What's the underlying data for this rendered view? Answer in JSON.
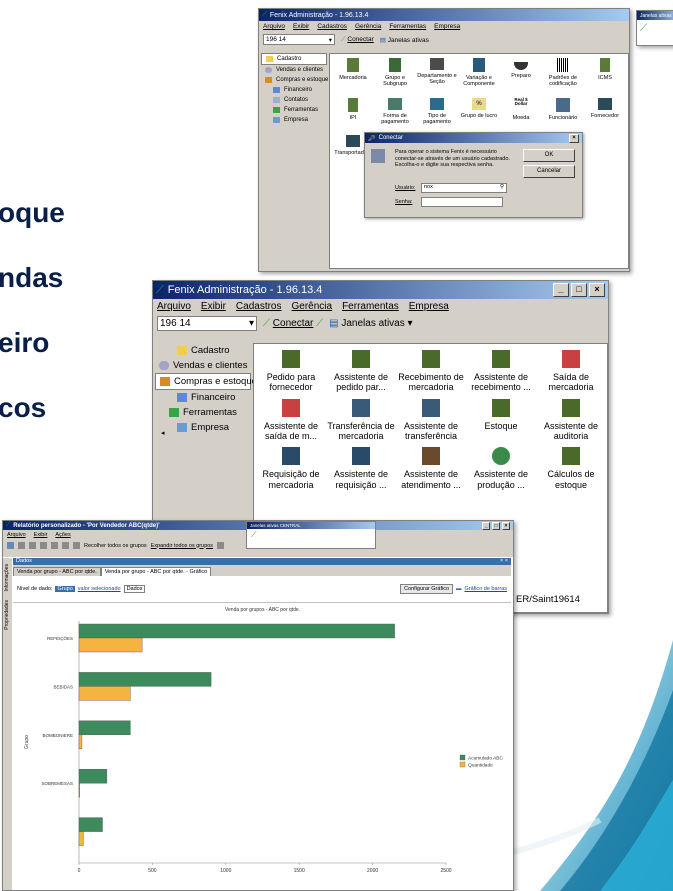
{
  "slide": {
    "bullets": [
      "oque",
      "ndas",
      "eiro",
      "cos"
    ]
  },
  "window_back": {
    "title": "Fenix Administração - 1.96.13.4",
    "menu": [
      "Arquivo",
      "Exibir",
      "Cadastros",
      "Gerência",
      "Ferramentas",
      "Empresa"
    ],
    "combo_value": "196 14",
    "conectar": "Conectar",
    "janelas": "Janelas ativas",
    "nav": [
      "Cadastro",
      "Vendas e clientes",
      "Compras e estoque",
      "Financeiro",
      "Contatos",
      "Ferramentas",
      "Empresa"
    ],
    "tiles": [
      "Mercadoria",
      "Grupo e Subgrupo",
      "Departamento e Seção",
      "Variação e Componente",
      "Preparo",
      "Padrões de codificação",
      "ICMS",
      "IPI",
      "Forma de pagamento",
      "Tipo de pagamento",
      "Grupo de lucro",
      "Moeda",
      "Funcionário",
      "Fornecedor",
      "Transportadora"
    ],
    "moeda_icon_text": "Real $ Dollar"
  },
  "mini_janelas": {
    "title": "Janelas ativas"
  },
  "dialog_conectar": {
    "title": "Conectar",
    "message": "Para operar o sistema Fenix é necessário conectar-se através de um usuário cadastrado. Escolha-o e digite sua respectiva senha.",
    "usuario_label": "Usuário:",
    "usuario_value": "nox",
    "senha_label": "Senha:",
    "ok": "OK",
    "cancelar": "Cancelar"
  },
  "window_mid": {
    "title": "Fenix Administração - 1.96.13.4",
    "menu": [
      "Arquivo",
      "Exibir",
      "Cadastros",
      "Gerência",
      "Ferramentas",
      "Empresa"
    ],
    "combo_value": "196 14",
    "conectar": "Conectar",
    "janelas": "Janelas ativas",
    "nav": [
      "Cadastro",
      "Vendas e clientes",
      "Compras e estoque",
      "Financeiro",
      "Ferramentas",
      "Empresa"
    ],
    "tiles": [
      "Pedido para fornecedor",
      "Assistente de pedido par...",
      "Recebimento de mercadoria",
      "Assistente de recebimento ...",
      "Saída de mercadoria",
      "Assistente de saída de m...",
      "Transferência de mercadoria",
      "Assistente de transferência",
      "Estoque",
      "Assistente de auditoria",
      "Requisição de mercadoria",
      "Assistente de requisição ...",
      "Assistente de atendimento ...",
      "Assistente de produção ...",
      "Cálculos de estoque"
    ],
    "status": "ER/Saint19614"
  },
  "window_front": {
    "title": "Relatório personalizado - 'Por Vendedor ABC(qtde)'",
    "menu": [
      "Arquivo",
      "Exibir",
      "Ações"
    ],
    "toolbar_links": [
      "Recolher todos os grupos",
      "Expandir todos os grupos"
    ],
    "side_tabs": [
      "Informações",
      "Propriedades"
    ],
    "panel_title": "Dados",
    "tabs": [
      "Venda por grupo - ABC por qtde.",
      "Venda por grupo - ABC por qtde. - Gráfico"
    ],
    "nivel_label": "Nível de dado:",
    "nivel_options": [
      "Grupo",
      "valor selecionado",
      "Dados"
    ],
    "config_button": "Configurar Gráfico",
    "grafico_link": "Gráfico de barras",
    "janelas_overlay": "Janelas ativas CENTRAL"
  },
  "chart_data": {
    "type": "bar",
    "orientation": "horizontal",
    "title": "Venda por grupos - ABC por qtde.",
    "ylabel": "Grupo",
    "xlabel": "",
    "categories": [
      "REFEIÇÕES",
      "BEBIDAS",
      "BOMBONIERE",
      "SOBREMESAS",
      ""
    ],
    "series": [
      {
        "name": "Acumulado ABC",
        "color": "#3d8a5c",
        "values": [
          2150,
          900,
          350,
          190,
          160
        ]
      },
      {
        "name": "Quantidade",
        "color": "#f5b440",
        "values": [
          430,
          350,
          20,
          5,
          30
        ]
      }
    ],
    "xlim": [
      0,
      2500
    ],
    "xticks": [
      0,
      500,
      1000,
      1500,
      2000,
      2500
    ],
    "legend_position": "right"
  }
}
